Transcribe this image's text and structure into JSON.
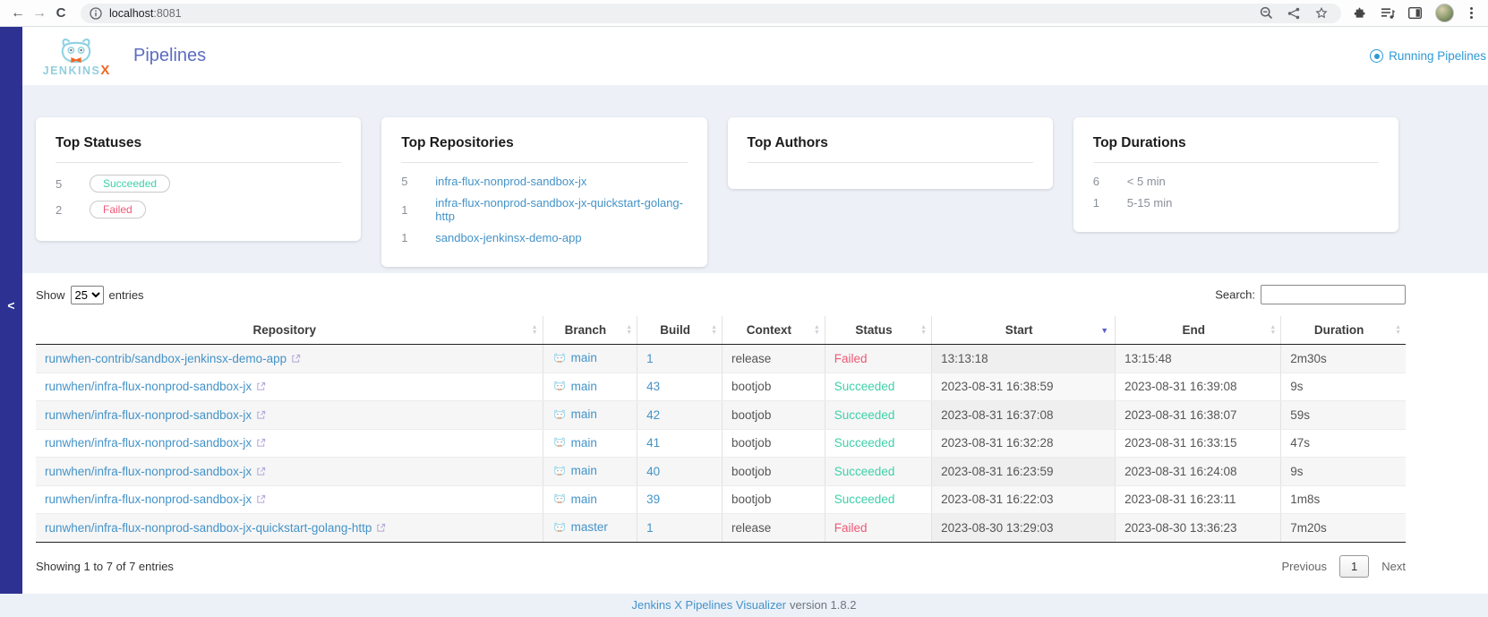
{
  "browser": {
    "url_host": "localhost",
    "url_port": ":8081",
    "icons": [
      "back-icon",
      "forward-icon",
      "reload-icon",
      "site-info-icon",
      "zoom-icon",
      "share-icon",
      "bookmark-star-icon",
      "extensions-icon",
      "reading-list-icon",
      "side-panel-icon",
      "profile-avatar",
      "browser-menu-icon"
    ]
  },
  "header": {
    "brand_jenkins": "JENKINS",
    "brand_x": "X",
    "title": "Pipelines",
    "running_pipelines_label": "Running Pipelines"
  },
  "sidebar": {
    "collapse_icon": "<"
  },
  "summary_cards": [
    {
      "title": "Top Statuses",
      "items": [
        {
          "count": "5",
          "label": "Succeeded",
          "kind": "badge",
          "status": "succeeded"
        },
        {
          "count": "2",
          "label": "Failed",
          "kind": "badge",
          "status": "failed"
        }
      ]
    },
    {
      "title": "Top Repositories",
      "items": [
        {
          "count": "5",
          "label": "infra-flux-nonprod-sandbox-jx",
          "kind": "link"
        },
        {
          "count": "1",
          "label": "infra-flux-nonprod-sandbox-jx-quickstart-golang-http",
          "kind": "link"
        },
        {
          "count": "1",
          "label": "sandbox-jenkinsx-demo-app",
          "kind": "link"
        }
      ]
    },
    {
      "title": "Top Authors",
      "items": []
    },
    {
      "title": "Top Durations",
      "items": [
        {
          "count": "6",
          "label": "< 5 min",
          "kind": "text"
        },
        {
          "count": "1",
          "label": "5-15 min",
          "kind": "text"
        }
      ]
    }
  ],
  "table_controls": {
    "show_label": "Show",
    "page_size": "25",
    "entries_label": "entries",
    "search_label": "Search:",
    "search_value": ""
  },
  "table": {
    "columns": [
      "Repository",
      "Branch",
      "Build",
      "Context",
      "Status",
      "Start",
      "End",
      "Duration"
    ],
    "sorted_column": "Start",
    "sort_direction": "desc",
    "rows": [
      {
        "repository": "runwhen-contrib/sandbox-jenkinsx-demo-app",
        "branch": "main",
        "build": "1",
        "context": "release",
        "status": "Failed",
        "start": "13:13:18",
        "end": "13:15:48",
        "duration": "2m30s"
      },
      {
        "repository": "runwhen/infra-flux-nonprod-sandbox-jx",
        "branch": "main",
        "build": "43",
        "context": "bootjob",
        "status": "Succeeded",
        "start": "2023-08-31 16:38:59",
        "end": "2023-08-31 16:39:08",
        "duration": "9s"
      },
      {
        "repository": "runwhen/infra-flux-nonprod-sandbox-jx",
        "branch": "main",
        "build": "42",
        "context": "bootjob",
        "status": "Succeeded",
        "start": "2023-08-31 16:37:08",
        "end": "2023-08-31 16:38:07",
        "duration": "59s"
      },
      {
        "repository": "runwhen/infra-flux-nonprod-sandbox-jx",
        "branch": "main",
        "build": "41",
        "context": "bootjob",
        "status": "Succeeded",
        "start": "2023-08-31 16:32:28",
        "end": "2023-08-31 16:33:15",
        "duration": "47s"
      },
      {
        "repository": "runwhen/infra-flux-nonprod-sandbox-jx",
        "branch": "main",
        "build": "40",
        "context": "bootjob",
        "status": "Succeeded",
        "start": "2023-08-31 16:23:59",
        "end": "2023-08-31 16:24:08",
        "duration": "9s"
      },
      {
        "repository": "runwhen/infra-flux-nonprod-sandbox-jx",
        "branch": "main",
        "build": "39",
        "context": "bootjob",
        "status": "Succeeded",
        "start": "2023-08-31 16:22:03",
        "end": "2023-08-31 16:23:11",
        "duration": "1m8s"
      },
      {
        "repository": "runwhen/infra-flux-nonprod-sandbox-jx-quickstart-golang-http",
        "branch": "master",
        "build": "1",
        "context": "release",
        "status": "Failed",
        "start": "2023-08-30 13:29:03",
        "end": "2023-08-30 13:36:23",
        "duration": "7m20s"
      }
    ]
  },
  "pagination": {
    "info": "Showing 1 to 7 of 7 entries",
    "previous_label": "Previous",
    "current_page": "1",
    "next_label": "Next"
  },
  "footer": {
    "link_label": "Jenkins X Pipelines Visualizer",
    "version_label": "version 1.8.2"
  },
  "colors": {
    "sidebar_indigo": "#2d3192",
    "link_blue": "#4493c8",
    "running_blue": "#2f99d6",
    "succeeded_teal": "#3ed0a8",
    "failed_pink": "#ee5876",
    "title_purple": "#5c6cc0",
    "brand_orange": "#f26722",
    "brand_lightblue": "#8ed2e4"
  }
}
